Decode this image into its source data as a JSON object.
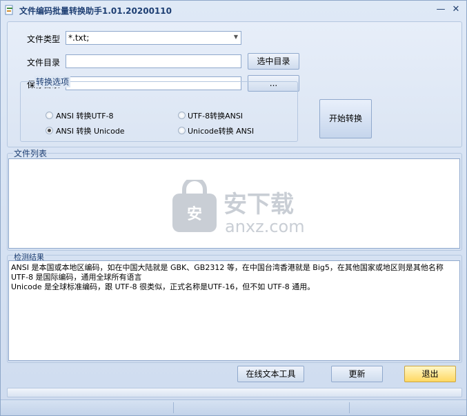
{
  "window": {
    "title": "文件编码批量转换助手1.01.20200110",
    "minimize": "—",
    "close": "✕"
  },
  "form": {
    "file_type_label": "文件类型",
    "file_type_value": "*.txt;",
    "file_dir_label": "文件目录",
    "file_dir_value": "",
    "select_dir_button": "选中目录",
    "save_dir_label": "保存目录",
    "save_dir_value": "",
    "browse_button": "..."
  },
  "options": {
    "title": "转换选项",
    "items": [
      {
        "label": "ANSI 转换UTF-8",
        "checked": false
      },
      {
        "label": "UTF-8转换ANSI",
        "checked": false
      },
      {
        "label": "ANSI 转换 Unicode",
        "checked": true
      },
      {
        "label": "Unicode转换 ANSI",
        "checked": false
      }
    ]
  },
  "start_button": "开始转换",
  "file_list": {
    "title": "文件列表",
    "watermark_cn": "安下载",
    "watermark_en": "anxz.com",
    "watermark_badge": "安"
  },
  "result": {
    "title": "检测结果",
    "text": "ANSI 是本国或本地区编码，如在中国大陆就是 GBK、GB2312 等，在中国台湾香港就是 Big5，在其他国家或地区则是其他名称\nUTF-8 是国际编码，通用全球所有语言\nUnicode 是全球标准编码，跟 UTF-8 很类似，正式名称是UTF-16，但不如 UTF-8 通用。"
  },
  "buttons": {
    "online_tools": "在线文本工具",
    "update": "更新",
    "exit": "退出"
  },
  "colors": {
    "accent": "#1e3f73",
    "exit_button": "#ffd862"
  }
}
